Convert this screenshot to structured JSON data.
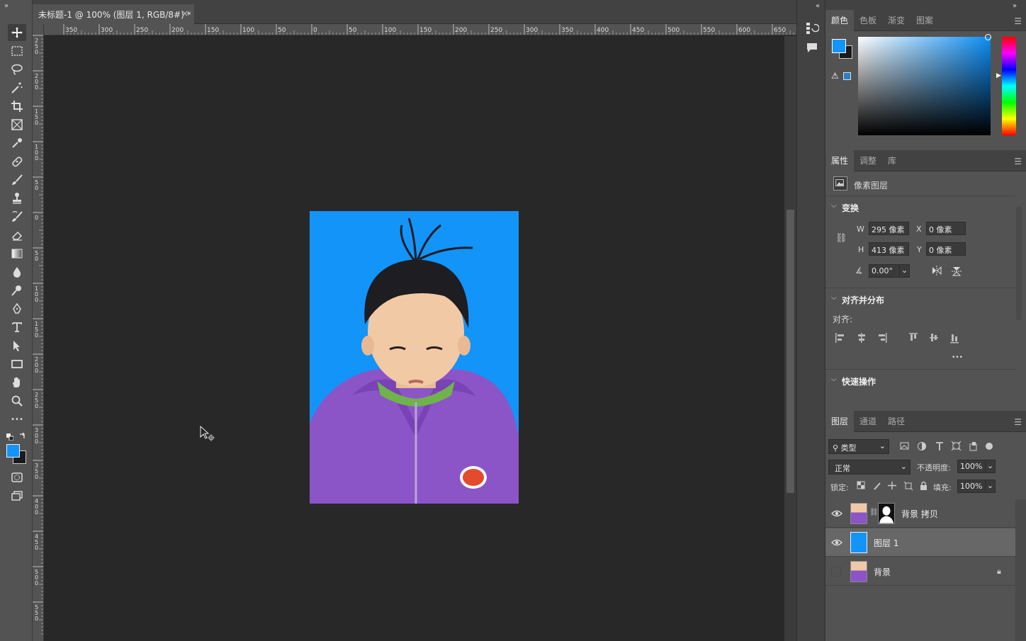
{
  "document": {
    "tab_title": "未标题-1 @ 100% (图层 1, RGB/8#) *",
    "close_glyph": "×"
  },
  "rulers": {
    "horizontal_labels": [
      "350",
      "300",
      "250",
      "200",
      "150",
      "100",
      "50",
      "0",
      "50",
      "100",
      "150",
      "200",
      "250",
      "300",
      "350",
      "400",
      "450",
      "500",
      "550",
      "600",
      "650"
    ],
    "vertical_labels": [
      "2\n5\n0",
      "2\n0\n0",
      "1\n5\n0",
      "1\n0\n0",
      "5\n0",
      "0",
      "5\n0",
      "1\n0\n0",
      "1\n5\n0",
      "2\n0\n0",
      "2\n5\n0",
      "3\n0\n0",
      "3\n5\n0",
      "4\n0\n0",
      "4\n5\n0",
      "5\n0\n0",
      "5\n5\n0"
    ]
  },
  "toolbar": {
    "collapse_glyph": "»",
    "more_glyph": "•••"
  },
  "colors": {
    "foreground": "#1394f8",
    "background": "#1a1a1a",
    "canvas_fill": "#1394f8"
  },
  "color_panel": {
    "tabs": [
      "颜色",
      "色板",
      "渐变",
      "图案"
    ],
    "active_tab": 0
  },
  "properties_panel": {
    "tabs": [
      "属性",
      "调整",
      "库"
    ],
    "active_tab": 0,
    "layer_kind": "像素图层",
    "transform": {
      "section_title": "变换",
      "w_label": "W",
      "w_value": "295 像素",
      "h_label": "H",
      "h_value": "413 像素",
      "x_label": "X",
      "x_value": "0 像素",
      "y_label": "Y",
      "y_value": "0 像素",
      "angle_value": "0.00°"
    },
    "align": {
      "section_title": "对齐并分布",
      "align_label": "对齐:",
      "more_glyph": "•••"
    },
    "quick_actions": {
      "section_title": "快速操作"
    }
  },
  "layers_panel": {
    "tabs": [
      "图层",
      "通道",
      "路径"
    ],
    "active_tab": 0,
    "filter_kind": "类型",
    "blend_mode": "正常",
    "opacity_label": "不透明度:",
    "opacity_value": "100%",
    "lock_label": "锁定:",
    "fill_label": "填充:",
    "fill_value": "100%",
    "layers": [
      {
        "name": "背景 拷贝",
        "visible": true,
        "selected": false,
        "has_mask": true,
        "locked": false
      },
      {
        "name": "图层 1",
        "visible": true,
        "selected": true,
        "has_mask": false,
        "locked": false
      },
      {
        "name": "背景",
        "visible": false,
        "selected": false,
        "has_mask": false,
        "locked": true
      }
    ]
  }
}
